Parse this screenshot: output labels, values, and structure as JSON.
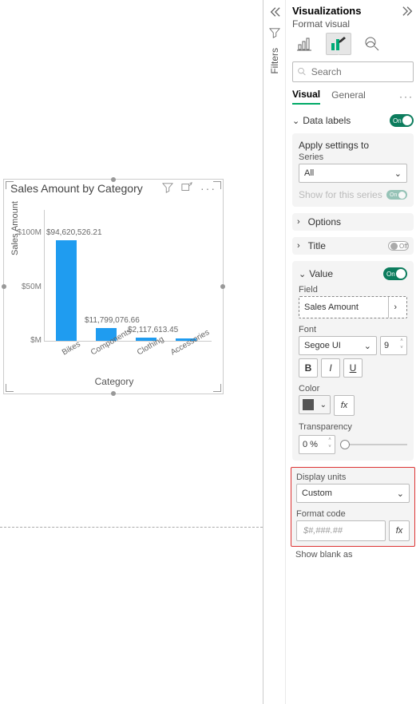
{
  "chart_data": {
    "type": "bar",
    "title": "Sales Amount by Category",
    "xlabel": "Category",
    "ylabel": "Sales Amount",
    "categories": [
      "Bikes",
      "Components",
      "Clothing",
      "Accessories"
    ],
    "values": [
      94620526.21,
      11799076.66,
      2117613.45,
      1200000
    ],
    "data_labels": [
      "$94,620,526.21",
      "$11,799,076.66",
      "$2,117,613.45",
      ""
    ],
    "yticks": [
      0,
      50000000,
      100000000
    ],
    "ytick_labels": [
      "$M",
      "$50M",
      "$100M"
    ],
    "ylim": [
      0,
      100000000
    ]
  },
  "filters_label": "Filters",
  "panel": {
    "title": "Visualizations",
    "subtitle": "Format visual",
    "search_placeholder": "Search",
    "tabs": {
      "visual": "Visual",
      "general": "General"
    },
    "data_labels": {
      "label": "Data labels",
      "toggle_text": "On"
    },
    "apply": {
      "title": "Apply settings to",
      "series_label": "Series",
      "series_value": "All",
      "show_series_label": "Show for this series",
      "show_series_toggle": "On"
    },
    "options": "Options",
    "title_row": {
      "label": "Title",
      "toggle_text": "Off"
    },
    "value": {
      "label": "Value",
      "toggle_text": "On",
      "field_label": "Field",
      "field_value": "Sales Amount",
      "font_label": "Font",
      "font_value": "Segoe UI",
      "font_size": "9",
      "bold": "B",
      "italic": "I",
      "underline": "U",
      "color_label": "Color",
      "fx_label": "fx",
      "transparency_label": "Transparency",
      "transparency_value": "0 %"
    },
    "display_units": {
      "label": "Display units",
      "value": "Custom",
      "format_code_label": "Format code",
      "format_code_value": "$#,###.##"
    },
    "show_blank_as": "Show blank as"
  }
}
